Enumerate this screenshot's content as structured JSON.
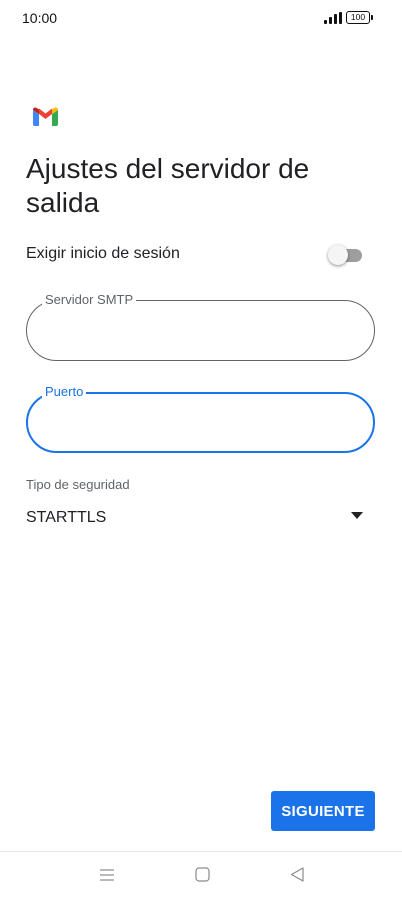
{
  "status_bar": {
    "time": "10:00",
    "battery": "100",
    "icons": [
      "signal-icon",
      "battery-icon"
    ]
  },
  "logo": {
    "icon": "gmail-logo-icon",
    "colors": [
      "#4285f4",
      "#ea4335",
      "#fbbc04",
      "#34a853",
      "#c5221f"
    ]
  },
  "header": {
    "title": "Ajustes del servidor de salida"
  },
  "auth": {
    "label": "Exigir inicio de sesión",
    "enabled": false
  },
  "smtp_field": {
    "label": "Servidor SMTP",
    "value": ""
  },
  "port_field": {
    "label": "Puerto",
    "value": "",
    "focused": true
  },
  "security": {
    "label": "Tipo de seguridad",
    "value": "STARTTLS",
    "icon": "dropdown-arrow-icon"
  },
  "actions": {
    "next_label": "SIGUIENTE"
  },
  "nav_bar": {
    "icons": [
      "menu-icon",
      "home-icon",
      "back-icon"
    ]
  },
  "colors": {
    "accent": "#1a73e8",
    "text": "#202124",
    "secondary_text": "#5f6368"
  }
}
